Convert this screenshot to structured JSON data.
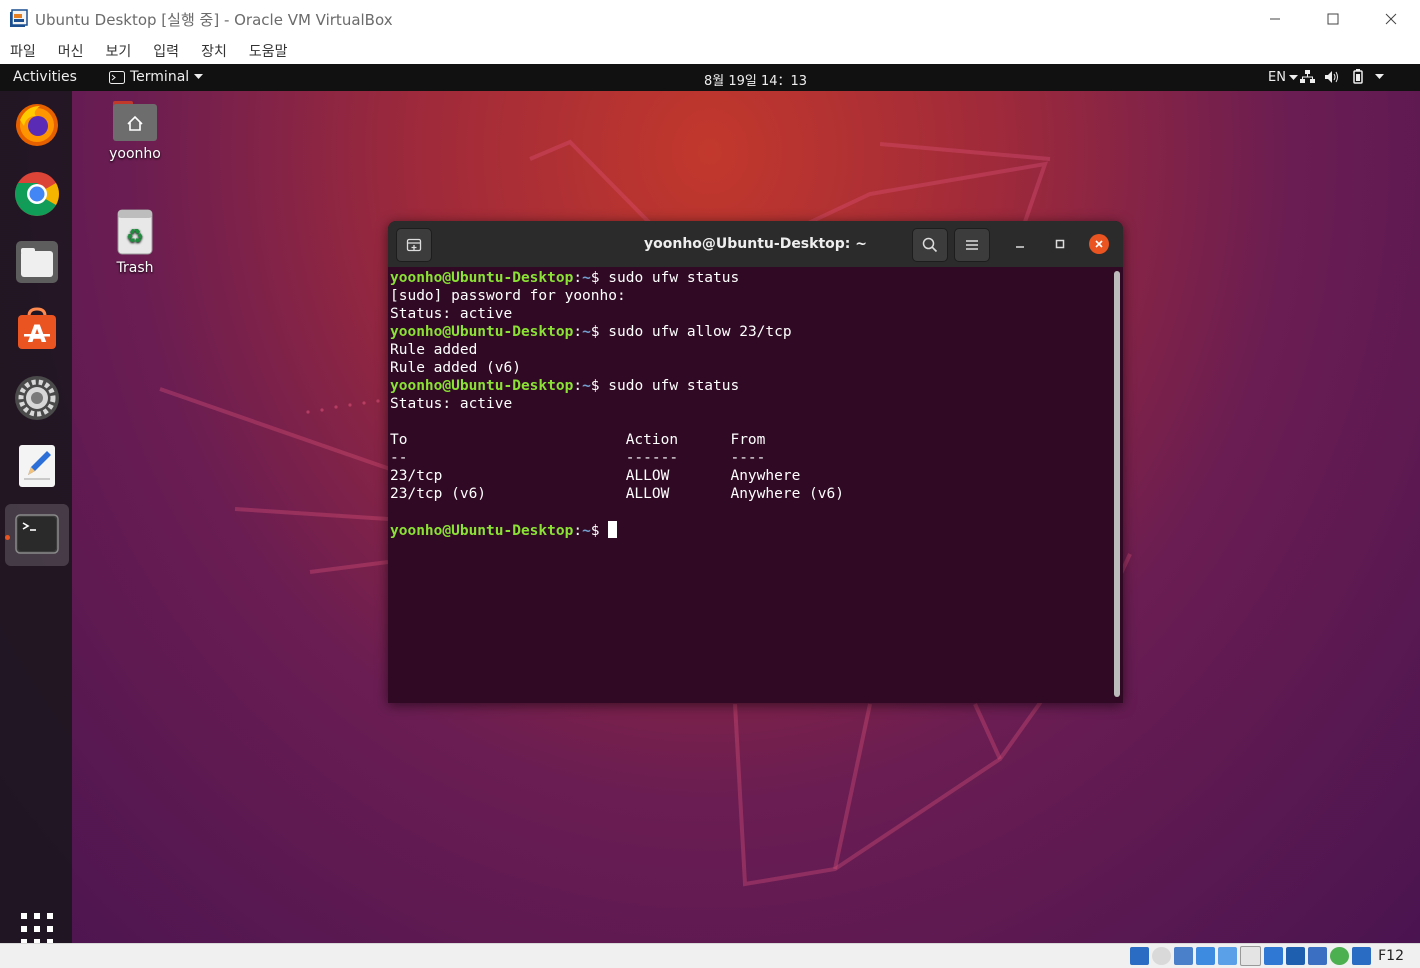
{
  "host_window": {
    "title": "Ubuntu Desktop [실행 중] - Oracle VM VirtualBox",
    "menu": [
      "파일",
      "머신",
      "보기",
      "입력",
      "장치",
      "도움말"
    ],
    "host_key": "F12"
  },
  "topbar": {
    "activities": "Activities",
    "app_name": "Terminal",
    "clock": "8월 19일  14：13",
    "language": "EN"
  },
  "dock": {
    "apps": [
      "Firefox",
      "Chrome",
      "Files",
      "Ubuntu Software",
      "Settings",
      "Text Editor",
      "Terminal"
    ],
    "active": "Terminal"
  },
  "desktop": {
    "icons": [
      {
        "label": "yoonho"
      },
      {
        "label": "Trash"
      }
    ]
  },
  "terminal": {
    "title": "yoonho@Ubuntu-Desktop: ~",
    "prompt_user": "yoonho@Ubuntu-Desktop",
    "prompt_path": "~",
    "lines": [
      {
        "kind": "prompt",
        "cmd": "sudo ufw status"
      },
      {
        "kind": "out",
        "text": "[sudo] password for yoonho:"
      },
      {
        "kind": "out",
        "text": "Status: active"
      },
      {
        "kind": "prompt",
        "cmd": "sudo ufw allow 23/tcp"
      },
      {
        "kind": "out",
        "text": "Rule added"
      },
      {
        "kind": "out",
        "text": "Rule added (v6)"
      },
      {
        "kind": "prompt",
        "cmd": "sudo ufw status"
      },
      {
        "kind": "out",
        "text": "Status: active"
      },
      {
        "kind": "out",
        "text": ""
      },
      {
        "kind": "out",
        "text": "To                         Action      From"
      },
      {
        "kind": "out",
        "text": "--                         ------      ----"
      },
      {
        "kind": "out",
        "text": "23/tcp                     ALLOW       Anywhere"
      },
      {
        "kind": "out",
        "text": "23/tcp (v6)                ALLOW       Anywhere (v6)"
      },
      {
        "kind": "out",
        "text": ""
      },
      {
        "kind": "prompt",
        "cmd": "",
        "cursor": true
      }
    ]
  },
  "colors": {
    "prompt_user": "#8ae234",
    "prompt_path": "#729fcf",
    "terminal_bg": "#300a24",
    "ubuntu_orange": "#e95420"
  }
}
